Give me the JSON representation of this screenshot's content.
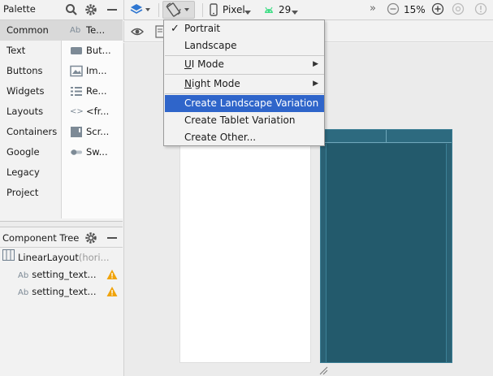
{
  "palette": {
    "title": "Palette",
    "categories": [
      "Common",
      "Text",
      "Buttons",
      "Widgets",
      "Layouts",
      "Containers",
      "Google",
      "Legacy",
      "Project"
    ],
    "items": [
      {
        "icon": "text-view-icon",
        "glyph": "Ab",
        "label": "Te..."
      },
      {
        "icon": "button-icon",
        "glyph": "",
        "label": "But..."
      },
      {
        "icon": "image-view-icon",
        "glyph": "",
        "label": "Im..."
      },
      {
        "icon": "recycler-view-icon",
        "glyph": "",
        "label": "Re..."
      },
      {
        "icon": "fragment-icon",
        "glyph": "<>",
        "label": "<fr..."
      },
      {
        "icon": "scroll-view-icon",
        "glyph": "",
        "label": "Scr..."
      },
      {
        "icon": "switch-icon",
        "glyph": "",
        "label": "Sw..."
      }
    ]
  },
  "component_tree": {
    "title": "Component Tree",
    "root": {
      "label": "LinearLayout",
      "suffix": "(hori..."
    },
    "children": [
      {
        "glyph": "Ab",
        "label": "setting_text..."
      },
      {
        "glyph": "Ab",
        "label": "setting_text..."
      }
    ]
  },
  "toolbar": {
    "device": "Pixel",
    "api": "29",
    "more": "»",
    "zoom": "15%"
  },
  "menu": {
    "portrait": "Portrait",
    "landscape": "Landscape",
    "ui_mode_pre": "U",
    "ui_mode_rest": "I Mode",
    "night_mode_pre": "N",
    "night_mode_rest": "ight Mode",
    "create_landscape": "Create Landscape Variation",
    "create_tablet": "Create Tablet Variation",
    "create_other": "Create Other..."
  },
  "colors": {
    "highlight": "#2f65ca",
    "device": "#2a6174",
    "warning": "#f0a30a",
    "android_green": "#3ddc84",
    "layers_blue": "#2f77d1"
  }
}
